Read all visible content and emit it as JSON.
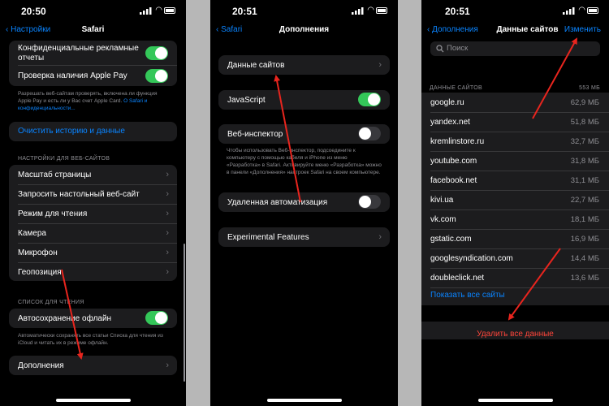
{
  "s1": {
    "time": "20:50",
    "back": "Настройки",
    "title": "Safari",
    "fraud_warning_label": "Конфиденциальные рекламные отчеты",
    "apple_pay_label": "Проверка наличия Apple Pay",
    "apple_pay_footer": "Разрешать веб-сайтам проверять, включена ли функция Apple Pay и есть ли у Вас счет Apple Card.",
    "apple_pay_footer_link": "О Safari и конфиденциальности...",
    "clear_history": "Очистить историю и данные",
    "websites_header": "НАСТРОЙКИ ДЛЯ ВЕБ-САЙТОВ",
    "website_items": [
      "Масштаб страницы",
      "Запросить настольный веб-сайт",
      "Режим для чтения",
      "Камера",
      "Микрофон",
      "Геопозиция"
    ],
    "reading_list_header": "СПИСОК ДЛЯ ЧТЕНИЯ",
    "offline_label": "Автосохранение офлайн",
    "offline_footer": "Автоматически сохранять все статьи Списка для чтения из iCloud и читать их в режиме офлайн.",
    "advanced_label": "Дополнения"
  },
  "s2": {
    "time": "20:51",
    "back": "Safari",
    "title": "Дополнения",
    "website_data": "Данные сайтов",
    "javascript": "JavaScript",
    "web_inspector": "Веб-инспектор",
    "web_inspector_footer": "Чтобы использовать Веб-инспектор, подсоедините к компьютеру с помощью кабеля и iPhone из меню «Разработка» в Safari. Активируйте меню «Разработка» можно в панели «Дополнения» настроек Safari на своем компьютере.",
    "remote_automation": "Удаленная автоматизация",
    "experimental": "Experimental Features"
  },
  "s3": {
    "time": "20:51",
    "back": "Дополнения",
    "title": "Данные сайтов",
    "edit": "Изменить",
    "search_placeholder": "Поиск",
    "section_header": "ДАННЫЕ САЙТОВ",
    "total": "553 МБ",
    "sites": [
      {
        "name": "google.ru",
        "size": "62,9 МБ"
      },
      {
        "name": "yandex.net",
        "size": "51,8 МБ"
      },
      {
        "name": "kremlinstore.ru",
        "size": "32,7 МБ"
      },
      {
        "name": "youtube.com",
        "size": "31,8 МБ"
      },
      {
        "name": "facebook.net",
        "size": "31,1 МБ"
      },
      {
        "name": "kivi.ua",
        "size": "22,7 МБ"
      },
      {
        "name": "vk.com",
        "size": "18,1 МБ"
      },
      {
        "name": "gstatic.com",
        "size": "16,9 МБ"
      },
      {
        "name": "googlesyndication.com",
        "size": "14,4 МБ"
      },
      {
        "name": "doubleclick.net",
        "size": "13,6 МБ"
      }
    ],
    "show_all": "Показать все сайты",
    "delete_all": "Удалить все данные"
  },
  "colors": {
    "accent": "#0a84ff",
    "toggle_on": "#34c759",
    "destructive": "#ff453a",
    "arrow": "#e8251e"
  },
  "icons": {
    "back": "chevron-left-icon",
    "disclosure": "chevron-right-icon",
    "search": "search-icon"
  }
}
